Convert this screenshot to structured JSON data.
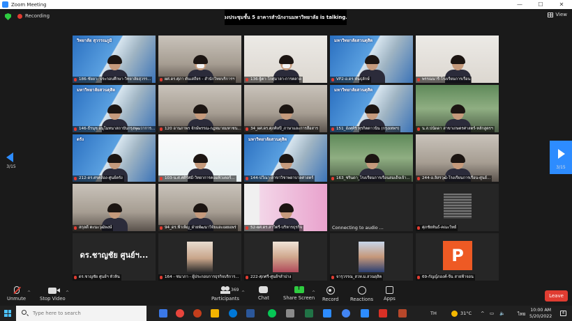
{
  "window": {
    "title": "Zoom Meeting",
    "controls": [
      "—",
      "☐",
      "✕"
    ]
  },
  "top": {
    "recording_label": "Recording",
    "speaker_banner": "ห้องประชุมชั้น 5 อาคารสำนักงานมหาวิทยาลัย is talking...",
    "view_label": "View"
  },
  "pager": {
    "left_count": "3/15",
    "right_count": "3/15"
  },
  "tiles": [
    {
      "type": "college",
      "label": "186-ชัยยา- ประกอบศึกษา-วิทยาลัยสุวรร...",
      "college_text": "วิทยาลัย สุวรรณภูมิ"
    },
    {
      "type": "room",
      "label": "ผศ.ดร.ศุภา ตันเสถียร - สำนักวิทยบริการฯ",
      "mask": true
    },
    {
      "type": "white",
      "label": "136-ฐิตา-โกศุมาลา-การตลาด",
      "mask": true
    },
    {
      "type": "college",
      "label": "VP2-อ.ดร.พันธุลักษ์",
      "college_text": "มหาวิทยาลัยสวนดุสิต"
    },
    {
      "type": "white",
      "label": "พรรณนารี-โรงเรียนการเรือน"
    },
    {
      "type": "college",
      "label": "146-ธีรนุช อนุโมทนาสถาบันกรุงพุฒวาการ...",
      "college_text": "มหาวิทยาลัยสวนดุสิต"
    },
    {
      "type": "room",
      "label": "120 อานภาพร จักษ์พรรณ-กฎหมายมหาชน..."
    },
    {
      "type": "room",
      "label": "34_ผศ.ดร.ศุภศิลปี_ภาษาและการสื่อสาร"
    },
    {
      "type": "college",
      "label": "151_อังศุศิริ ทุรกิตตาวนิน (กรุงเทพฯ)",
      "college_text": "มหาวิทยาลัยสวนดุสิต"
    },
    {
      "type": "green",
      "label": "น.ส.ปนัดดา สาขาเกษตรศาสตร์-หลักสูตรฯ"
    },
    {
      "type": "college",
      "label": "212-ดร.ศรศล้อง-ศูนย์ตรัง",
      "college_text": "ตรัง"
    },
    {
      "type": "poster",
      "label": "103-น.ศ.ศศิรัศมี-วิทยาการคอมพิวเตอร์..."
    },
    {
      "type": "college",
      "label": "144-ปวีณา-สาขาวิชาพยาบาลศาสตร์",
      "college_text": "มหาวิทยาลัยสวนดุสิต"
    },
    {
      "type": "green",
      "label": "163_ชรินดา_โรงเรียนการเรือนสมเด็จเจ้า..."
    },
    {
      "type": "room",
      "label": "244-อ.ลิสรวุฒิ-โรงเรียนการเรือน-ศูนย์..."
    },
    {
      "type": "room",
      "label": "สกุลดี ตะนะวุฒิพงษ์"
    },
    {
      "type": "room",
      "label": "94_ดร.ฟ้าเพ็ญ_ฝ่ายพัฒนาวิจัยและเผยแพร่"
    },
    {
      "type": "pink",
      "label": "52-ผศ.ดร.สาวิตรี-บริหารธุรกิจ"
    },
    {
      "type": "dark",
      "connecting": "Connecting to audio ..."
    },
    {
      "type": "dark-qr",
      "label": "ศุภชัยพันธ์-คณะวิทย์"
    },
    {
      "type": "dark-name",
      "big_name": "ดร.ชาญชัย ศูนย์ฯ...",
      "label": "ดร.ชาญชัย ศูนย์ฯ หัวหิน"
    },
    {
      "type": "dark-photo",
      "label": "164 - ชนาภา - ผู้ประกอบการธุรกิจบริการ..."
    },
    {
      "type": "dark-photo",
      "label": "222-ศุภศรี-ศูนย์ฯลำปาง"
    },
    {
      "type": "dark-photo-blue",
      "label": "จารุวรรณ_สวท.ม.สวนดุสิต"
    },
    {
      "type": "dark-avatar",
      "avatar_letter": "P",
      "label": "69-กัญญ์ภองค์-จีน สายฟ้าจอน"
    }
  ],
  "toolbar": {
    "unmute": "Unmute",
    "stop_video": "Stop Video",
    "participants": "Participants",
    "participant_count": "369",
    "chat": "Chat",
    "share_screen": "Share Screen",
    "record": "Record",
    "reactions": "Reactions",
    "apps": "Apps",
    "leave": "Leave"
  },
  "taskbar": {
    "search_placeholder": "Type here to search",
    "lang": "TH",
    "temperature": "31°C",
    "lang2": "ไทย",
    "time": "10:00 AM",
    "date": "5/20/2022",
    "notification_count": "4"
  },
  "colors": {
    "zoom_blue": "#2d8cff",
    "leave_red": "#e03c31",
    "share_green": "#2ecc40",
    "avatar_orange": "#ee5a24"
  }
}
